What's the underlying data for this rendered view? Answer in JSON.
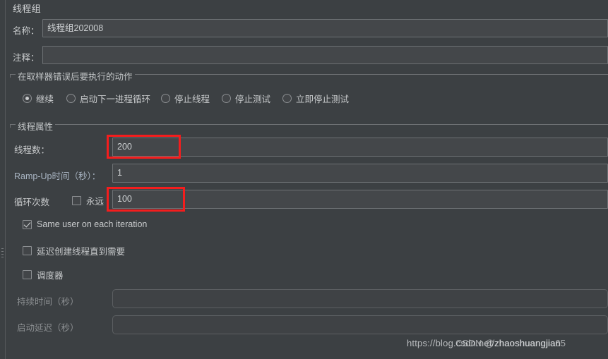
{
  "window": {
    "title": "线程组",
    "background_color": "#3c4043",
    "accent_red": "#f41d1d"
  },
  "fields": {
    "name": {
      "label": "名称：",
      "value": "线程组202008",
      "placeholder": ""
    },
    "comment": {
      "label": "注释：",
      "value": "",
      "placeholder": ""
    }
  },
  "error_action_group": {
    "title": "在取样器错误后要执行的动作",
    "selected": "继续",
    "options": [
      {
        "label": "继续",
        "checked": true
      },
      {
        "label": "启动下一进程循环",
        "checked": false
      },
      {
        "label": "停止线程",
        "checked": false
      },
      {
        "label": "停止测试",
        "checked": false
      },
      {
        "label": "立即停止测试",
        "checked": false
      }
    ]
  },
  "thread_properties": {
    "title": "线程属性",
    "thread_count": {
      "label": "线程数：",
      "value": "200",
      "highlighted": true
    },
    "ramp_up": {
      "label": "Ramp-Up时间（秒）：",
      "value": "1",
      "highlighted": false
    },
    "loop_count": {
      "label": "循环次数",
      "forever_label": "永远",
      "forever_checked": false,
      "value": "100",
      "highlighted": true
    },
    "checkboxes": [
      {
        "label": "Same user on each iteration",
        "checked": true,
        "enabled": true
      },
      {
        "label": "延迟创建线程直到需要",
        "checked": false,
        "enabled": true
      },
      {
        "label": "调度器",
        "checked": false,
        "enabled": true
      }
    ],
    "duration": {
      "label": "持续时间（秒）",
      "value": "",
      "enabled": false
    },
    "startup_delay": {
      "label": "启动延迟（秒）",
      "value": "",
      "enabled": false
    }
  },
  "watermarks": [
    {
      "text": "https://blog.csdn.net/zhaoshuangjian"
    },
    {
      "text": "CSDN @zhaoshuangjia65"
    }
  ]
}
